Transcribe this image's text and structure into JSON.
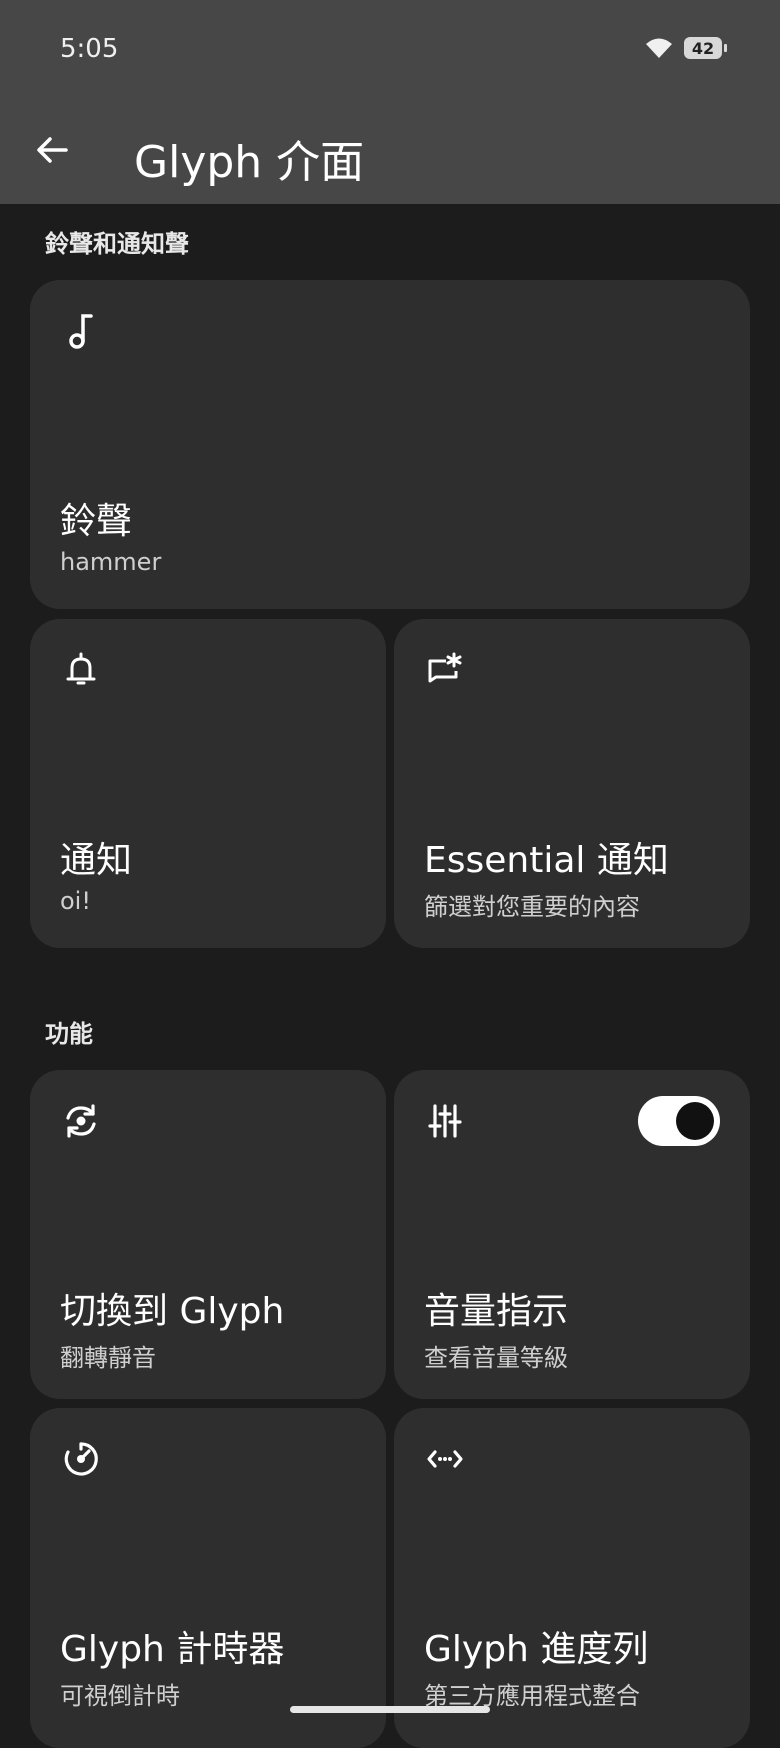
{
  "status": {
    "time": "5:05",
    "battery": "42"
  },
  "header": {
    "title": "Glyph 介面"
  },
  "sections": {
    "ringtones": "鈴聲和通知聲",
    "features": "功能"
  },
  "cards": {
    "ringtone": {
      "title": "鈴聲",
      "subtitle": "hammer",
      "icon": "music-note-icon"
    },
    "notification": {
      "title": "通知",
      "subtitle": "oi!",
      "icon": "bell-icon"
    },
    "essential": {
      "title": "Essential 通知",
      "subtitle": "篩選對您重要的內容",
      "icon": "essential-notification-icon"
    },
    "flip": {
      "title": "切換到 Glyph",
      "subtitle": "翻轉靜音",
      "icon": "flip-sync-icon"
    },
    "volume": {
      "title": "音量指示",
      "subtitle": "查看音量等級",
      "icon": "sliders-icon",
      "toggle_on": true
    },
    "timer": {
      "title": "Glyph 計時器",
      "subtitle": "可視倒計時",
      "icon": "timer-icon"
    },
    "progress": {
      "title": "Glyph 進度列",
      "subtitle": "第三方應用程式整合",
      "icon": "code-arrows-icon"
    }
  }
}
